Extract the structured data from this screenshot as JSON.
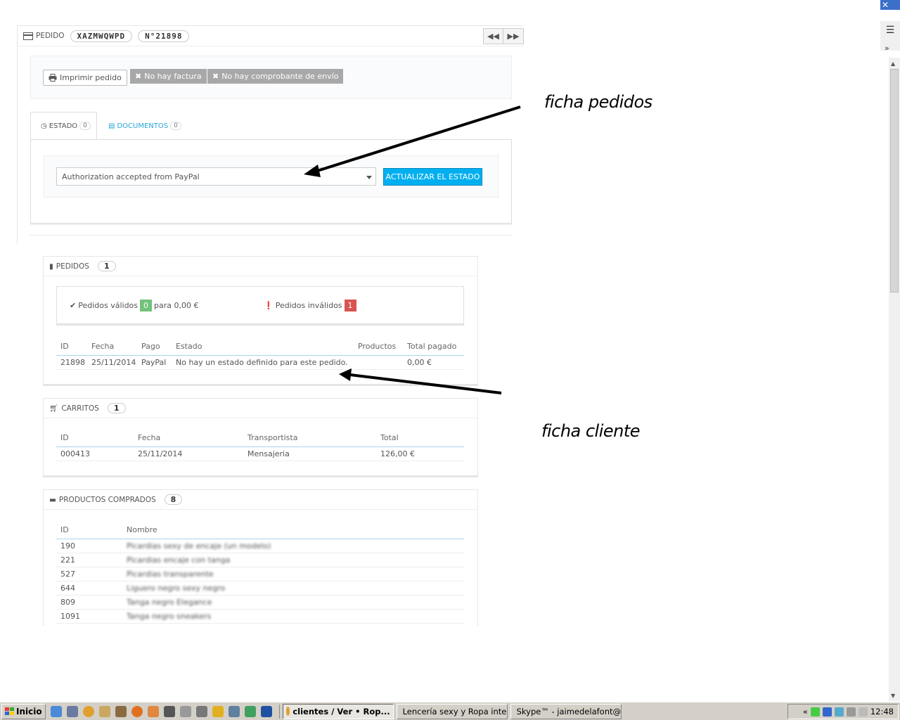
{
  "order_panel": {
    "title": "PEDIDO",
    "reference": "XAZMWQWPD",
    "number": "N°21898",
    "print_button": "Imprimir pedido",
    "no_invoice": "No hay factura",
    "no_delivery_slip": "No hay comprobante de envío",
    "tabs": [
      {
        "label": "ESTADO",
        "count": "0"
      },
      {
        "label": "DOCUMENTOS",
        "count": "0"
      }
    ],
    "status_select_value": "Authorization accepted from PayPal",
    "update_button": "ACTUALIZAR EL ESTADO"
  },
  "orders_panel": {
    "title": "PEDIDOS",
    "count": "1",
    "valid_label": "Pedidos válidos",
    "valid_count": "0",
    "valid_amount": "para 0,00 €",
    "invalid_label": "Pedidos inválidos",
    "invalid_count": "1",
    "columns": [
      "ID",
      "Fecha",
      "Pago",
      "Estado",
      "Productos",
      "Total pagado"
    ],
    "rows": [
      {
        "id": "21898",
        "date": "25/11/2014",
        "payment": "PayPal",
        "status": "No hay un estado definido para este pedido.",
        "products": "",
        "total": "0,00 €"
      }
    ]
  },
  "carts_panel": {
    "title": "CARRITOS",
    "count": "1",
    "columns": [
      "ID",
      "Fecha",
      "Transportista",
      "Total"
    ],
    "rows": [
      {
        "id": "000413",
        "date": "25/11/2014",
        "carrier": "Mensajeria",
        "total": "126,00 €"
      }
    ]
  },
  "products_panel": {
    "title": "PRODUCTOS COMPRADOS",
    "count": "8",
    "columns": [
      "ID",
      "Nombre"
    ],
    "rows": [
      {
        "id": "190",
        "name": "Picardias sexy de encaje (un modelo)"
      },
      {
        "id": "221",
        "name": "Picardias encaje con tanga"
      },
      {
        "id": "527",
        "name": "Picardias transparente"
      },
      {
        "id": "644",
        "name": "Liguero negro sexy negro"
      },
      {
        "id": "809",
        "name": "Tanga negro Elegance"
      },
      {
        "id": "1091",
        "name": "Tanga negro sneakers"
      }
    ]
  },
  "annotations": {
    "orders_note": "ficha pedidos",
    "customer_note": "ficha cliente"
  },
  "taskbar": {
    "start": "Inicio",
    "tasks": [
      "clientes / Ver • Rop...",
      "Lencería sexy y Ropa inte...",
      "Skype™ - jaimedelafont@..."
    ],
    "clock": "12:48"
  },
  "colors": {
    "accent": "#00aff0",
    "link": "#2aa6d9",
    "valid_badge": "#72c279",
    "invalid_badge": "#d9534f"
  }
}
